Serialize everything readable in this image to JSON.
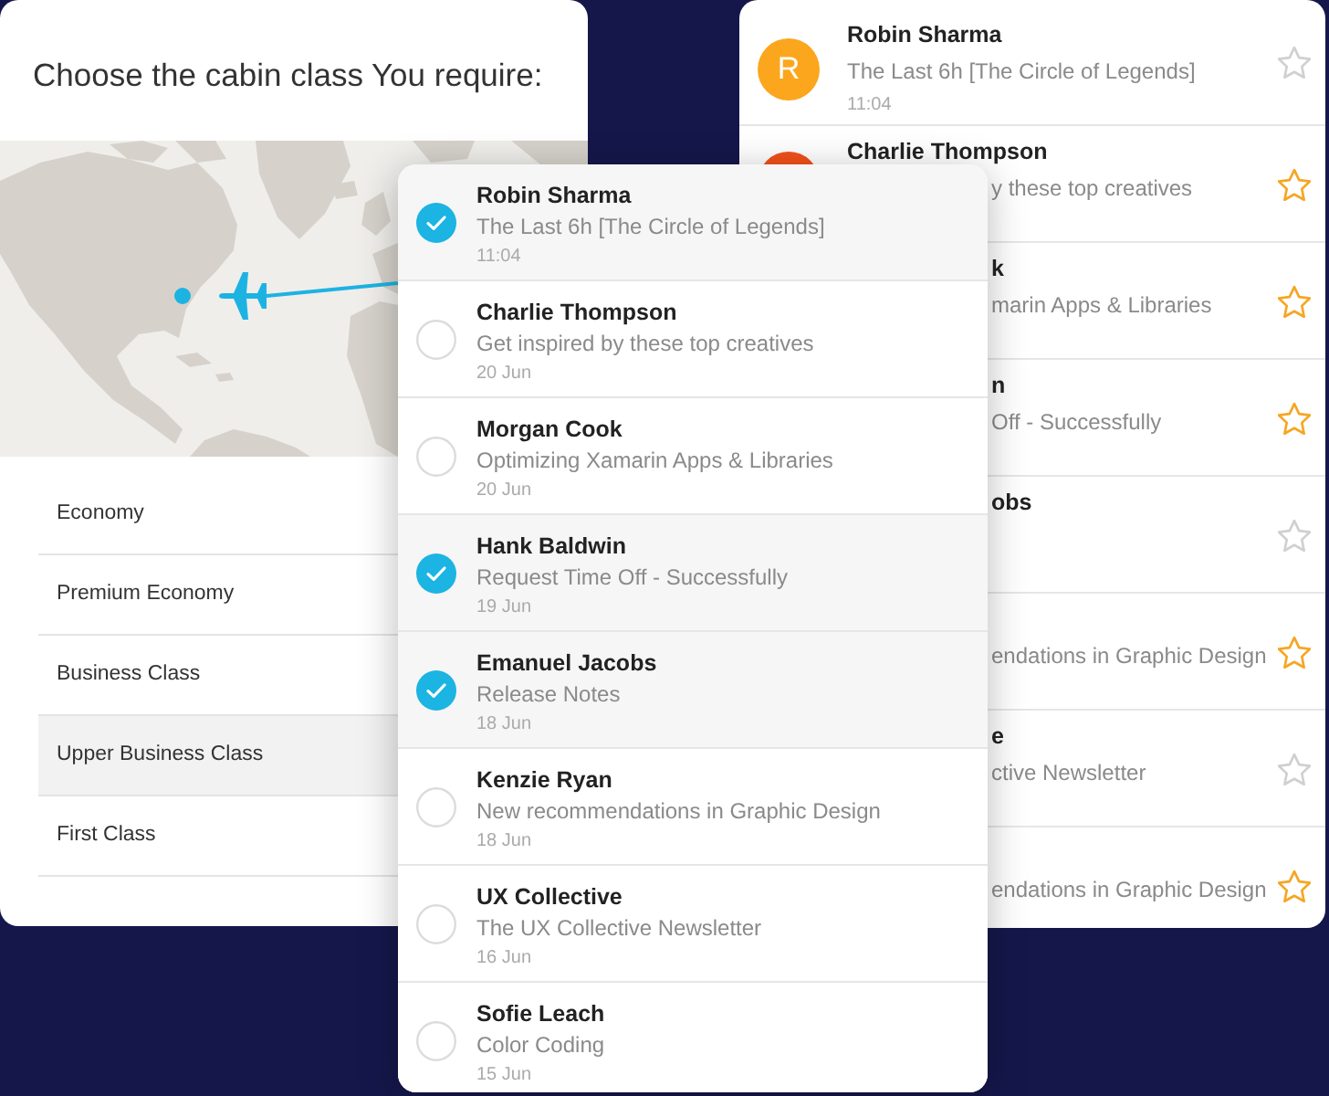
{
  "cabin_panel": {
    "title": "Choose the cabin class You require:",
    "classes": [
      {
        "label": "Economy",
        "selected": false
      },
      {
        "label": "Premium Economy",
        "selected": false
      },
      {
        "label": "Business Class",
        "selected": false
      },
      {
        "label": "Upper Business Class",
        "selected": true
      },
      {
        "label": "First Class",
        "selected": false
      }
    ]
  },
  "starred_list": {
    "messages": [
      {
        "avatar": {
          "letter": "R",
          "color": "#fba61c"
        },
        "sender": "Robin Sharma",
        "subject": "The Last 6h [The Circle of Legends]",
        "date": "11:04",
        "starred": false
      },
      {
        "avatar": {
          "color": "#f2511b"
        },
        "sender": "Charlie Thompson",
        "subject": "y these top creatives",
        "starred": true
      },
      {
        "sender": "k",
        "subject": "marin Apps & Libraries",
        "starred": true
      },
      {
        "sender": "n",
        "subject": "Off - Successfully",
        "starred": true
      },
      {
        "sender": "obs",
        "starred": false
      },
      {
        "subject": "endations in Graphic Design",
        "starred": true
      },
      {
        "sender": "e",
        "subject": "ctive Newsletter",
        "starred": false
      },
      {
        "subject": "endations in Graphic Design",
        "starred": true
      }
    ]
  },
  "message_list": {
    "messages": [
      {
        "sender": "Robin Sharma",
        "subject": "The Last 6h [The Circle of Legends]",
        "date": "11:04",
        "checked": true
      },
      {
        "sender": "Charlie Thompson",
        "subject": "Get inspired by these top creatives",
        "date": "20 Jun",
        "checked": false
      },
      {
        "sender": "Morgan Cook",
        "subject": "Optimizing Xamarin Apps & Libraries",
        "date": "20 Jun",
        "checked": false
      },
      {
        "sender": "Hank Baldwin",
        "subject": "Request Time Off - Successfully",
        "date": "19 Jun",
        "checked": true
      },
      {
        "sender": "Emanuel Jacobs",
        "subject": "Release Notes",
        "date": "18 Jun",
        "checked": true
      },
      {
        "sender": "Kenzie Ryan",
        "subject": "New recommendations in Graphic Design",
        "date": "18 Jun",
        "checked": false
      },
      {
        "sender": "UX Collective",
        "subject": "The UX Collective Newsletter",
        "date": "16 Jun",
        "checked": false
      },
      {
        "sender": "Sofie Leach",
        "subject": "Color Coding",
        "date": "15 Jun",
        "checked": false
      }
    ]
  }
}
